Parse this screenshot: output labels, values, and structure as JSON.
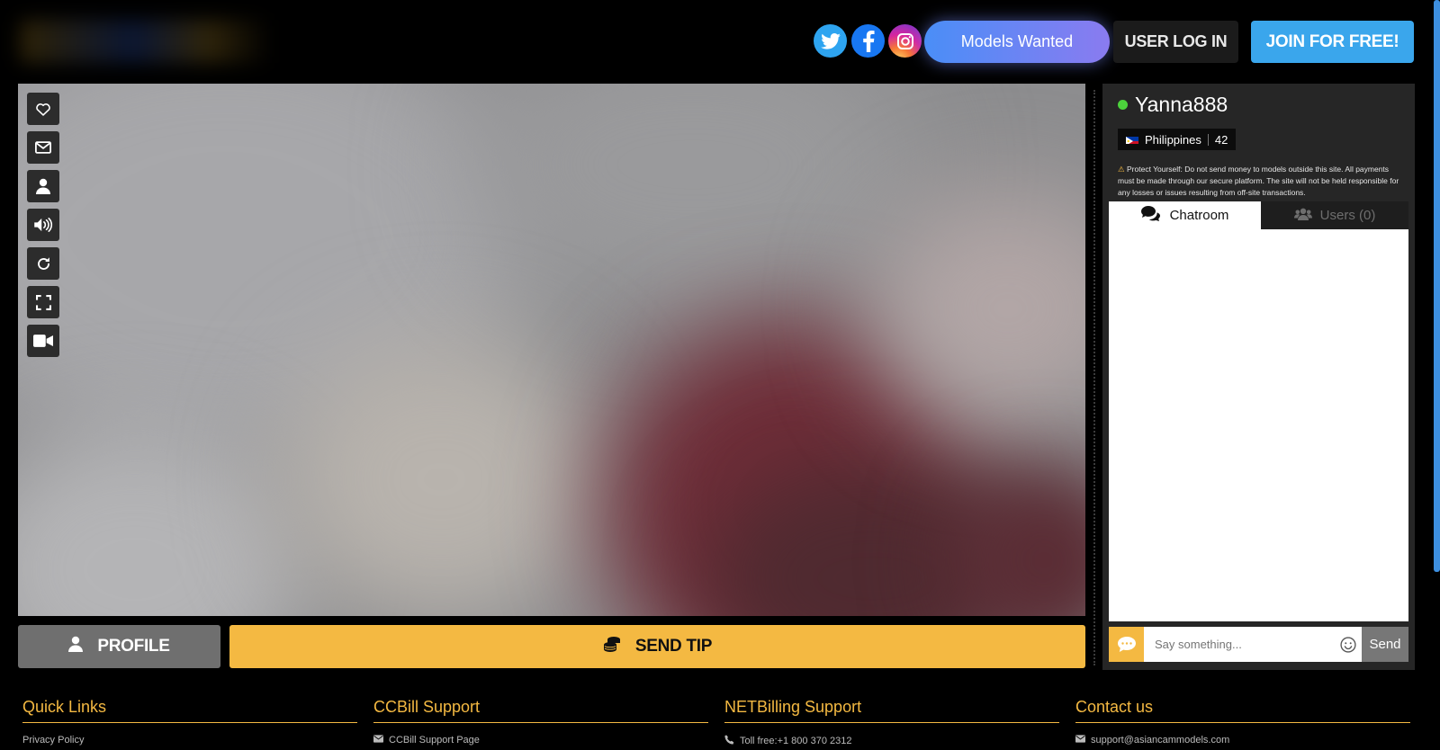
{
  "header": {
    "social": [
      {
        "name": "twitter",
        "icon": "twitter-icon"
      },
      {
        "name": "facebook",
        "icon": "facebook-icon"
      },
      {
        "name": "instagram",
        "icon": "instagram-icon"
      }
    ],
    "models_wanted_label": "Models Wanted",
    "login_label": "USER LOG IN",
    "join_label": "JOIN FOR FREE!"
  },
  "video": {
    "controls": [
      "heart-icon",
      "envelope-icon",
      "user-icon",
      "volume-icon",
      "refresh-icon",
      "fullscreen-icon",
      "video-camera-icon"
    ]
  },
  "actions": {
    "profile_label": "PROFILE",
    "tip_label": "SEND TIP"
  },
  "model": {
    "name": "Yanna888",
    "status_color": "#4cd23c",
    "country": "Philippines",
    "age": "42",
    "warning": "Protect Yourself: Do not send money to models outside this site. All payments must be made through our secure platform. The site will not be held responsible for any losses or issues resulting from off-site transactions."
  },
  "chat": {
    "tabs": {
      "chatroom": "Chatroom",
      "users": "Users (0)"
    },
    "input_placeholder": "Say something...",
    "send_label": "Send"
  },
  "footer": {
    "columns": [
      {
        "title": "Quick Links",
        "link": "Privacy Policy",
        "icon": ""
      },
      {
        "title": "CCBill Support",
        "link": "CCBill Support Page",
        "icon": "envelope-icon"
      },
      {
        "title": "NETBilling Support",
        "link": "Toll free:+1 800 370 2312",
        "icon": "phone-icon"
      },
      {
        "title": "Contact us",
        "link": "support@asiancammodels.com",
        "icon": "envelope-icon"
      }
    ]
  },
  "colors": {
    "accent_yellow": "#f4b942",
    "join_blue": "#3aa6ec",
    "panel_bg": "#262626"
  }
}
